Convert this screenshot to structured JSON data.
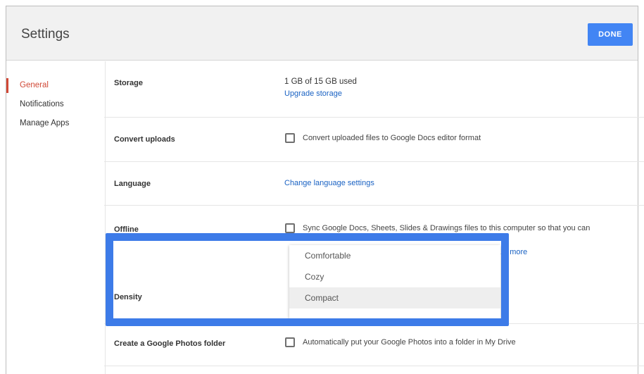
{
  "header": {
    "title": "Settings",
    "done_label": "DONE"
  },
  "sidebar": {
    "items": [
      {
        "label": "General",
        "active": true
      },
      {
        "label": "Notifications",
        "active": false
      },
      {
        "label": "Manage Apps",
        "active": false
      }
    ]
  },
  "settings": {
    "storage": {
      "label": "Storage",
      "value": "1 GB of 15 GB used",
      "link": "Upgrade storage"
    },
    "convert_uploads": {
      "label": "Convert uploads",
      "checkbox_label": "Convert uploaded files to Google Docs editor format",
      "checked": false
    },
    "language": {
      "label": "Language",
      "link": "Change language settings"
    },
    "offline": {
      "label": "Offline",
      "checkbox_label": "Sync Google Docs, Sheets, Slides & Drawings files to this computer so that you can",
      "link": "Learn more",
      "checked": false
    },
    "density": {
      "label": "Density",
      "options": [
        "Comfortable",
        "Cozy",
        "Compact"
      ],
      "selected": "Compact"
    },
    "photos": {
      "label": "Create a Google Photos folder",
      "checkbox_label": "Automatically put your Google Photos into a folder in My Drive",
      "checked": false
    }
  },
  "colors": {
    "accent": "#4285f4",
    "active_nav": "#d14836",
    "link": "#1a62c3",
    "highlight": "#3d7be8"
  }
}
